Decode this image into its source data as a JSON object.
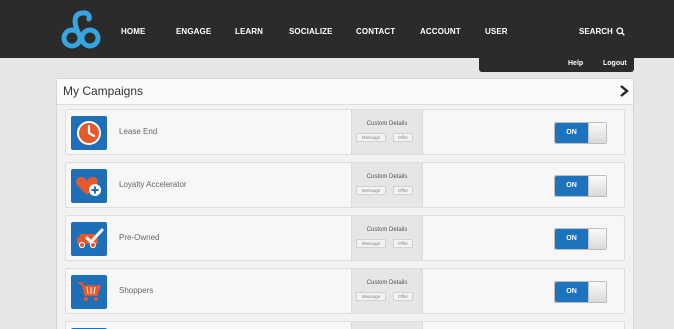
{
  "nav": {
    "items": [
      "HOME",
      "ENGAGE",
      "LEARN",
      "SOCIALIZE",
      "CONTACT",
      "ACCOUNT",
      "USER"
    ],
    "search_label": "SEARCH",
    "sub_links": [
      "Help",
      "Logout"
    ]
  },
  "colors": {
    "nav_bg": "#2b2b2b",
    "logo_blue": "#37a6e0",
    "accent_blue": "#1e73be",
    "icon_orange": "#e7582a"
  },
  "campaigns": {
    "title": "My Campaigns",
    "details_title": "Custom Details",
    "message_label": "Message",
    "offer_label": "Offer",
    "toggle_label": "ON",
    "rows": [
      {
        "label": "Lease End",
        "icon": "clock-icon",
        "state": "ON"
      },
      {
        "label": "Loyalty Accelerator",
        "icon": "heart-plus-icon",
        "state": "ON"
      },
      {
        "label": "Pre-Owned",
        "icon": "car-check-icon",
        "state": "ON"
      },
      {
        "label": "Shoppers",
        "icon": "cart-icon",
        "state": "ON"
      }
    ]
  }
}
